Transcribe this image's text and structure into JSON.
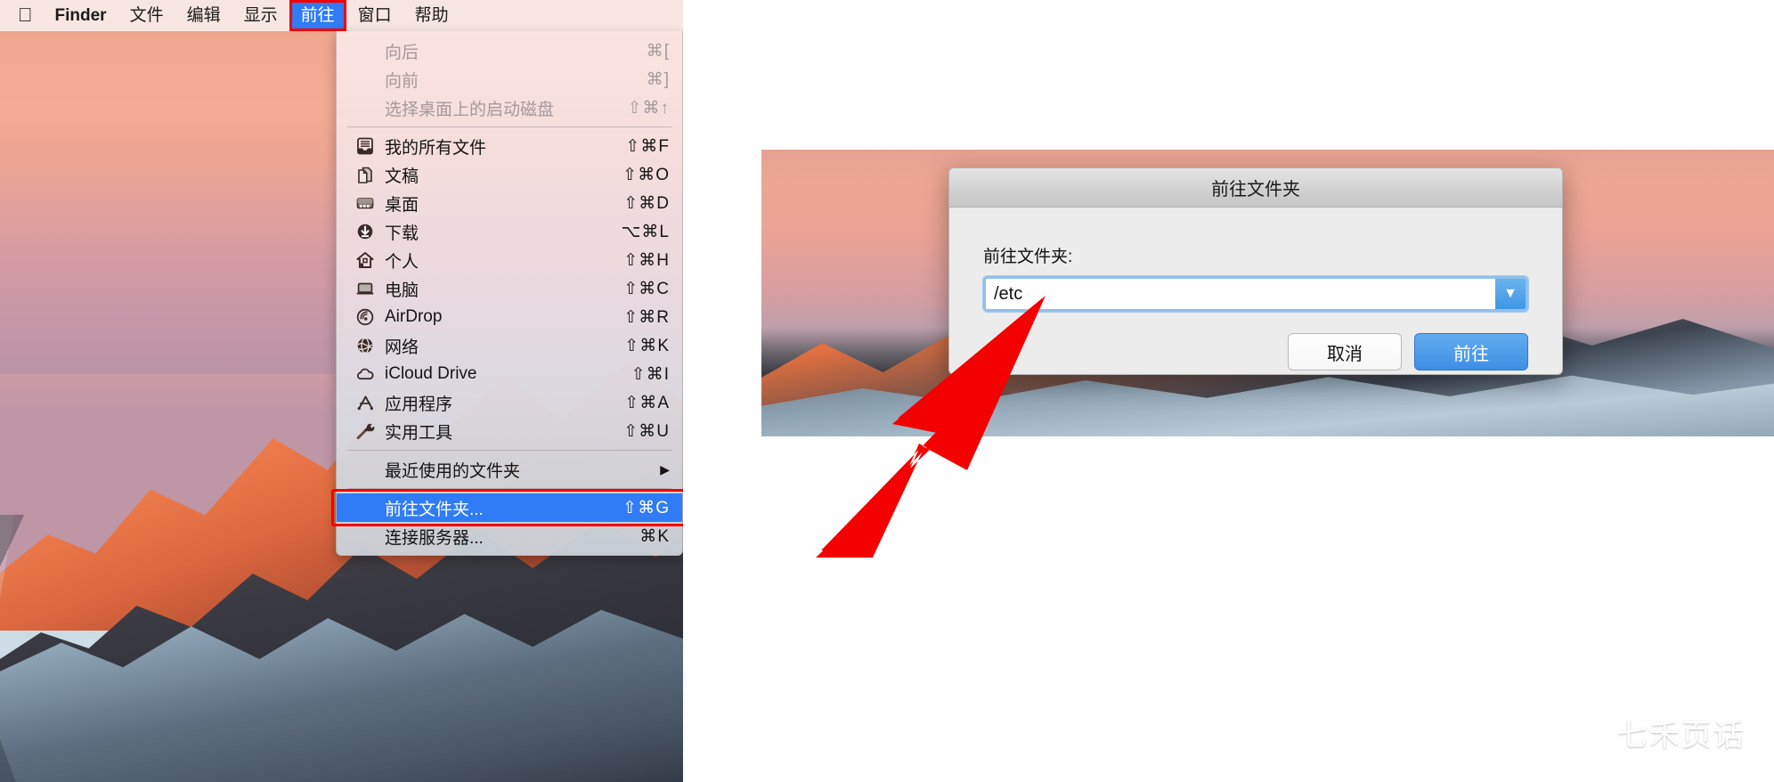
{
  "menubar": {
    "apple_icon": "apple-logo-icon",
    "items": [
      {
        "label": "Finder",
        "bold": true,
        "active": false
      },
      {
        "label": "文件",
        "bold": false,
        "active": false
      },
      {
        "label": "编辑",
        "bold": false,
        "active": false
      },
      {
        "label": "显示",
        "bold": false,
        "active": false
      },
      {
        "label": "前往",
        "bold": false,
        "active": true
      },
      {
        "label": "窗口",
        "bold": false,
        "active": false
      },
      {
        "label": "帮助",
        "bold": false,
        "active": false
      }
    ],
    "highlight_color": "#2f7cf6",
    "annotation_color": "#f40000"
  },
  "go_menu": {
    "groups": [
      {
        "items": [
          {
            "label": "向后",
            "shortcut": "⌘[",
            "icon": "",
            "disabled": true,
            "selected": false
          },
          {
            "label": "向前",
            "shortcut": "⌘]",
            "icon": "",
            "disabled": true,
            "selected": false
          },
          {
            "label": "选择桌面上的启动磁盘",
            "shortcut": "⇧⌘↑",
            "icon": "",
            "disabled": true,
            "selected": false
          }
        ]
      },
      {
        "items": [
          {
            "label": "我的所有文件",
            "shortcut": "⇧⌘F",
            "icon": "all-my-files-icon",
            "disabled": false,
            "selected": false
          },
          {
            "label": "文稿",
            "shortcut": "⇧⌘O",
            "icon": "documents-icon",
            "disabled": false,
            "selected": false
          },
          {
            "label": "桌面",
            "shortcut": "⇧⌘D",
            "icon": "desktop-icon",
            "disabled": false,
            "selected": false
          },
          {
            "label": "下载",
            "shortcut": "⌥⌘L",
            "icon": "downloads-icon",
            "disabled": false,
            "selected": false
          },
          {
            "label": "个人",
            "shortcut": "⇧⌘H",
            "icon": "home-icon",
            "disabled": false,
            "selected": false
          },
          {
            "label": "电脑",
            "shortcut": "⇧⌘C",
            "icon": "computer-icon",
            "disabled": false,
            "selected": false
          },
          {
            "label": "AirDrop",
            "shortcut": "⇧⌘R",
            "icon": "airdrop-icon",
            "disabled": false,
            "selected": false
          },
          {
            "label": "网络",
            "shortcut": "⇧⌘K",
            "icon": "network-icon",
            "disabled": false,
            "selected": false
          },
          {
            "label": "iCloud Drive",
            "shortcut": "⇧⌘I",
            "icon": "icloud-icon",
            "disabled": false,
            "selected": false
          },
          {
            "label": "应用程序",
            "shortcut": "⇧⌘A",
            "icon": "applications-icon",
            "disabled": false,
            "selected": false
          },
          {
            "label": "实用工具",
            "shortcut": "⇧⌘U",
            "icon": "utilities-icon",
            "disabled": false,
            "selected": false
          }
        ]
      },
      {
        "items": [
          {
            "label": "最近使用的文件夹",
            "shortcut": "",
            "submenu": true,
            "icon": "",
            "disabled": false,
            "selected": false
          }
        ]
      },
      {
        "items": [
          {
            "label": "前往文件夹...",
            "shortcut": "⇧⌘G",
            "icon": "",
            "disabled": false,
            "selected": true
          },
          {
            "label": "连接服务器...",
            "shortcut": "⌘K",
            "icon": "",
            "disabled": false,
            "selected": false
          }
        ]
      }
    ]
  },
  "dialog": {
    "title": "前往文件夹",
    "field_label": "前往文件夹:",
    "path_value": "/etc",
    "dropdown_icon": "chevron-down-icon",
    "cancel_label": "取消",
    "go_label": "前往",
    "default_button_color": "#3d8ee4"
  },
  "annotation": {
    "arrow_color": "#f40000",
    "arrow_name": "red-pointer-arrow"
  },
  "watermark": {
    "icon": "wechat-icon",
    "text": "七禾页话"
  }
}
